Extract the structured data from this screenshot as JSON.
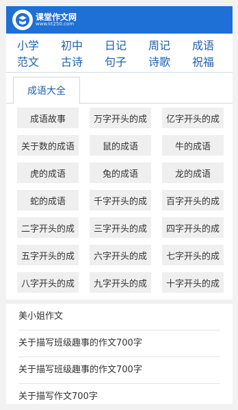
{
  "header": {
    "logo_name": "课堂作文网",
    "logo_url": "www.kt250.com",
    "bg_color": "#1e6fd6"
  },
  "nav": {
    "rows": [
      [
        "小学",
        "初中",
        "日记",
        "周记",
        "成语"
      ],
      [
        "范文",
        "古诗",
        "句子",
        "诗歌",
        "祝福"
      ]
    ]
  },
  "tabs": {
    "active": "成语大全"
  },
  "idiom_grid": [
    [
      "成语故事",
      "万字开头的成",
      "亿字开头的成"
    ],
    [
      "关于数的成语",
      "鼠的成语",
      "牛的成语"
    ],
    [
      "虎的成语",
      "兔的成语",
      "龙的成语"
    ],
    [
      "蛇的成语",
      "千字开头的成",
      "百字开头的成"
    ],
    [
      "二字开头的成",
      "三字开头的成",
      "四字开头的成"
    ],
    [
      "五字开头的成",
      "六字开头的成",
      "七字开头的成"
    ],
    [
      "八字开头的成",
      "九字开头的成",
      "十字开头的成"
    ]
  ],
  "article_list": [
    "美小姐作文",
    "关于描写班级趣事的作文700字",
    "关于描写班级趣事的作文700字",
    "关于描写作文700字"
  ]
}
